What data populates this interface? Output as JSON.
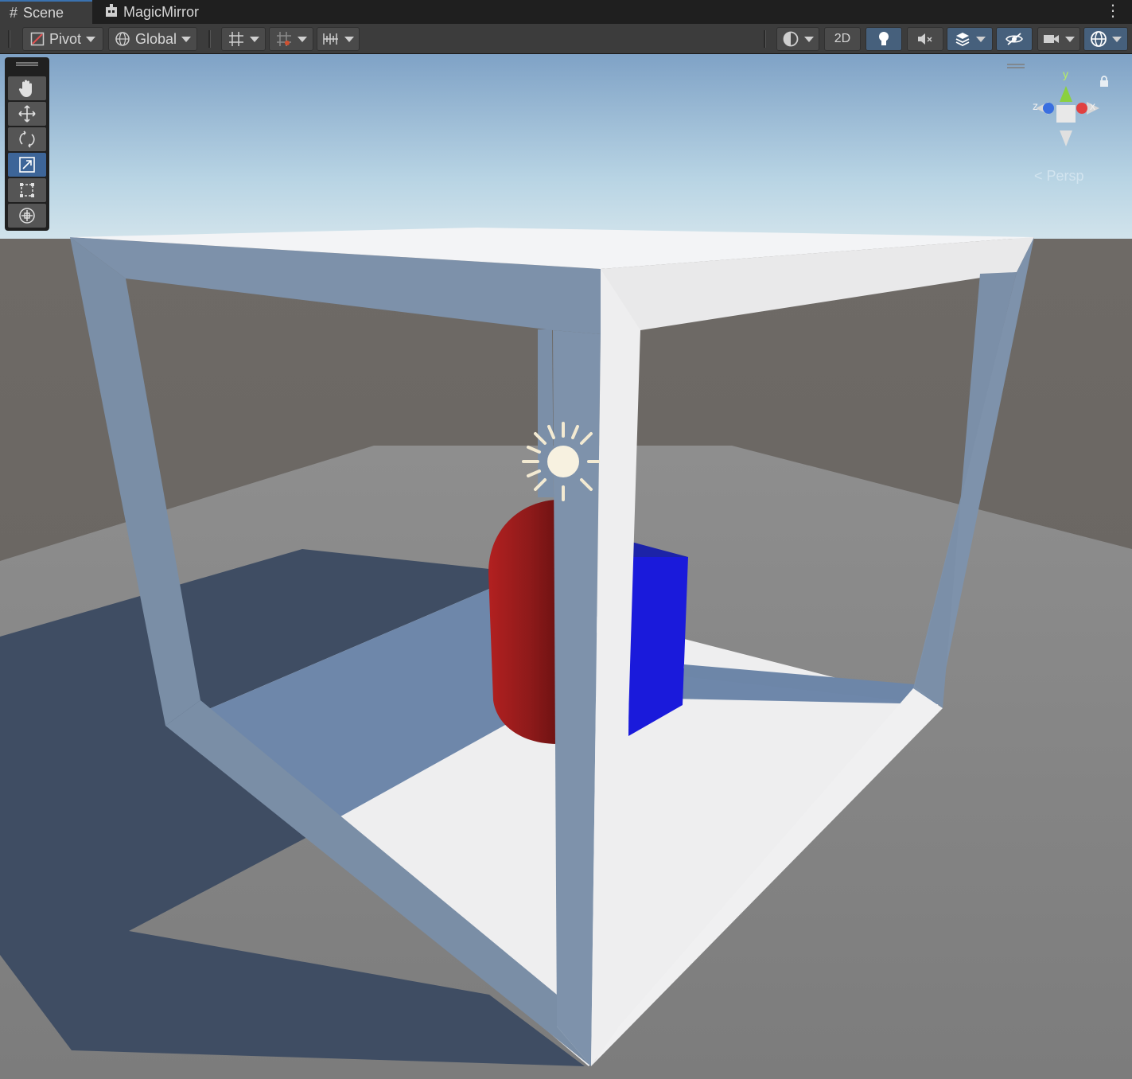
{
  "tabs": [
    {
      "label": "Scene",
      "icon": "grid-hash-icon",
      "active": true
    },
    {
      "label": "MagicMirror",
      "icon": "game-controller-icon",
      "active": false
    }
  ],
  "toolbar": {
    "pivot_label": "Pivot",
    "global_label": "Global",
    "mode_2d_label": "2D"
  },
  "tools": [
    "hand-tool",
    "move-tool",
    "rotate-tool",
    "scale-tool",
    "rect-tool",
    "transform-tool"
  ],
  "active_tool": "scale-tool",
  "gizmo": {
    "projection_label": "Persp",
    "axis_y": "y",
    "axis_x": "x",
    "axis_z": "z"
  },
  "colors": {
    "accent": "#3d6598",
    "capsule": "#8e1a1a",
    "cube": "#1a1adb",
    "frame": "#e8e8ea",
    "floor": "#f0f0f0"
  }
}
